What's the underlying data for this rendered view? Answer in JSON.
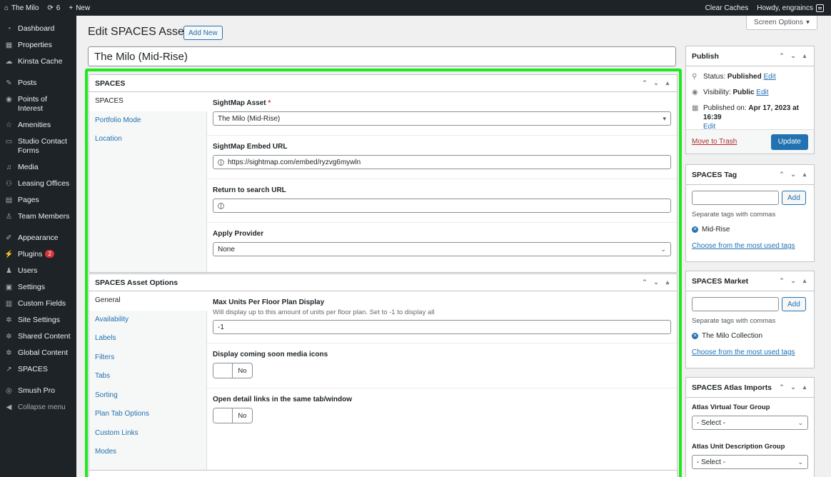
{
  "adminbar": {
    "site_name": "The Milo",
    "updates_count": "6",
    "new_label": "New",
    "clear_caches": "Clear Caches",
    "howdy": "Howdy, engraincs"
  },
  "sidebar": {
    "items": [
      {
        "label": "Dashboard",
        "icon": "dashboard-icon"
      },
      {
        "label": "Properties",
        "icon": "building-icon"
      },
      {
        "label": "Kinsta Cache",
        "icon": "cloud-icon"
      },
      {
        "label": "Posts",
        "icon": "pin-icon"
      },
      {
        "label": "Points of Interest",
        "icon": "location-icon"
      },
      {
        "label": "Amenities",
        "icon": "star-icon"
      },
      {
        "label": "Studio Contact Forms",
        "icon": "inbox-icon"
      },
      {
        "label": "Media",
        "icon": "media-icon"
      },
      {
        "label": "Leasing Offices",
        "icon": "groups-icon"
      },
      {
        "label": "Pages",
        "icon": "page-icon"
      },
      {
        "label": "Team Members",
        "icon": "person-icon"
      },
      {
        "label": "Appearance",
        "icon": "brush-icon"
      },
      {
        "label": "Plugins",
        "icon": "plug-icon",
        "badge": "2"
      },
      {
        "label": "Users",
        "icon": "user-icon"
      },
      {
        "label": "Settings",
        "icon": "settings-icon"
      },
      {
        "label": "Custom Fields",
        "icon": "table-icon"
      },
      {
        "label": "Site Settings",
        "icon": "gear-icon"
      },
      {
        "label": "Shared Content",
        "icon": "gear-icon"
      },
      {
        "label": "Global Content",
        "icon": "gear-icon"
      },
      {
        "label": "SPACES",
        "icon": "arrow-icon"
      },
      {
        "label": "Smush Pro",
        "icon": "smush-icon"
      },
      {
        "label": "Collapse menu",
        "icon": "collapse-icon"
      }
    ]
  },
  "header": {
    "title": "Edit SPACES Asset",
    "add_new": "Add New",
    "screen_options": "Screen Options"
  },
  "post_title": "The Milo (Mid-Rise)",
  "spaces_box": {
    "title": "SPACES",
    "tabs": [
      "SPACES",
      "Portfolio Mode",
      "Location"
    ],
    "fields": {
      "asset_label": "SightMap Asset",
      "asset_required": "*",
      "asset_value": "The Milo (Mid-Rise)",
      "embed_label": "SightMap Embed URL",
      "embed_value": "https://sightmap.com/embed/ryzvg6mywln",
      "return_label": "Return to search URL",
      "return_value": "",
      "provider_label": "Apply Provider",
      "provider_value": "None"
    }
  },
  "options_box": {
    "title": "SPACES Asset Options",
    "tabs": [
      "General",
      "Availability",
      "Labels",
      "Filters",
      "Tabs",
      "Sorting",
      "Plan Tab Options",
      "Custom Links",
      "Modes"
    ],
    "fields": {
      "max_units_label": "Max Units Per Floor Plan Display",
      "max_units_desc": "Will display up to this amount of units per floor plan. Set to -1 to display all",
      "max_units_value": "-1",
      "coming_soon_label": "Display coming soon media icons",
      "coming_soon_value": "No",
      "detail_links_label": "Open detail links in the same tab/window",
      "detail_links_value": "No"
    }
  },
  "publish": {
    "title": "Publish",
    "status_label": "Status:",
    "status_value": "Published",
    "visibility_label": "Visibility:",
    "visibility_value": "Public",
    "published_label": "Published on:",
    "published_value": "Apr 17, 2023 at 16:39",
    "edit": "Edit",
    "trash": "Move to Trash",
    "update": "Update"
  },
  "tag_box": {
    "title": "SPACES Tag",
    "add": "Add",
    "help": "Separate tags with commas",
    "tag": "Mid-Rise",
    "choose": "Choose from the most used tags"
  },
  "market_box": {
    "title": "SPACES Market",
    "add": "Add",
    "help": "Separate tags with commas",
    "tag": "The Milo Collection",
    "choose": "Choose from the most used tags"
  },
  "atlas_box": {
    "title": "SPACES Atlas Imports",
    "virtual_label": "Atlas Virtual Tour Group",
    "virtual_value": "- Select -",
    "unit_label": "Atlas Unit Description Group",
    "unit_value": "- Select -"
  }
}
